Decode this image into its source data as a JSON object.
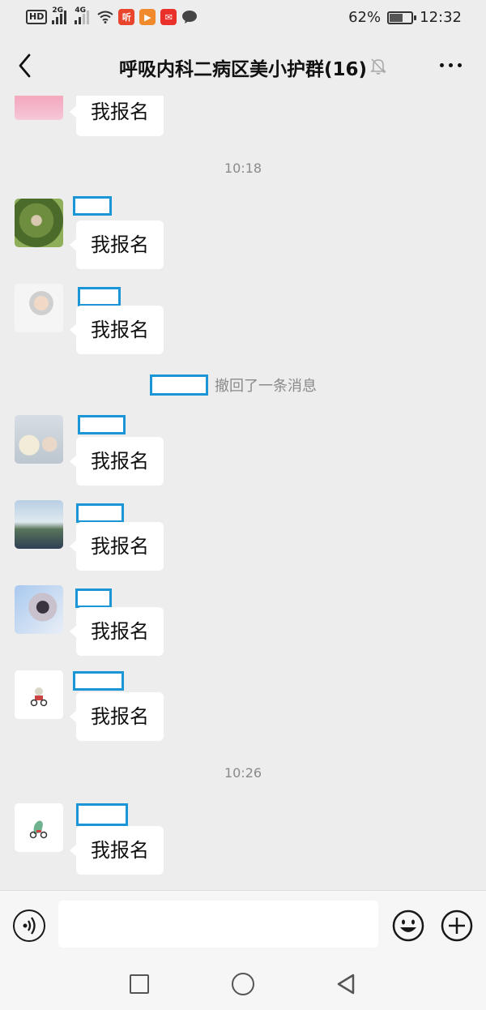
{
  "status_bar": {
    "hd_label": "HD",
    "network_1": "2G",
    "network_2": "4G",
    "battery_percent": "62%",
    "battery_level": 0.62,
    "time": "12:32",
    "app_icons": [
      "ting-icon",
      "video-icon",
      "weibo-icon",
      "chat-bubble-icon"
    ]
  },
  "header": {
    "title": "呼吸内科二病区美小护群(16)",
    "back_icon": "back-chevron-icon",
    "mute_icon": "bell-muted-icon",
    "more_icon": "more-dots-icon"
  },
  "messages": {
    "m0": {
      "text": "我报名"
    },
    "time1": "10:18",
    "m1": {
      "text": "我报名"
    },
    "m2": {
      "text": "我报名"
    },
    "recall_text": "撤回了一条消息",
    "m3": {
      "text": "我报名"
    },
    "m4": {
      "text": "我报名"
    },
    "m5": {
      "text": "我报名"
    },
    "m6": {
      "text": "我报名"
    },
    "time2": "10:26",
    "m7": {
      "text": "我报名"
    }
  },
  "input_bar": {
    "voice_icon": "voice-icon",
    "emoji_icon": "emoji-icon",
    "plus_icon": "plus-icon"
  },
  "nav_bar": {
    "icons": [
      "recent-apps-icon",
      "home-icon",
      "back-triangle-icon"
    ]
  },
  "colors": {
    "background": "#ededed",
    "bubble": "#ffffff",
    "redaction": "#1a96d6"
  }
}
